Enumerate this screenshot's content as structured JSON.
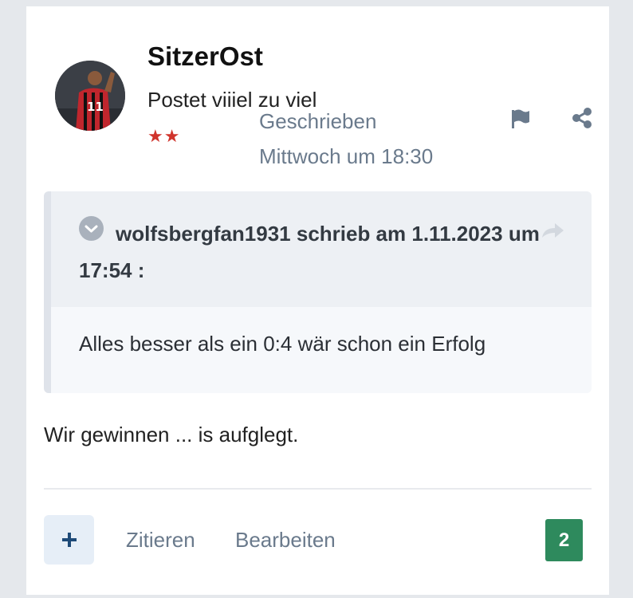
{
  "post": {
    "author": {
      "name": "SitzerOst",
      "title": "Postet viiiel zu viel",
      "rank_stars": "★★"
    },
    "date_label": "Geschrieben",
    "date_value": "Mittwoch um 18:30",
    "quote": {
      "author_line": "wolfsbergfan1931 schrieb am 1.11.2023 um 17:54 :",
      "text": "Alles besser als ein 0:4 wär schon ein Erfolg"
    },
    "content": "Wir gewinnen ... is aufglegt.",
    "actions": {
      "quote_label": "Zitieren",
      "edit_label": "Bearbeiten"
    },
    "reaction_count": "2"
  },
  "icons": {
    "report": "flag-icon",
    "share": "share-icon",
    "toggle": "chevron-down-icon",
    "quote_link": "arrow-share-icon",
    "add": "plus-icon"
  },
  "colors": {
    "accent_text": "#6a7a8c",
    "reaction_green": "#2e8a5d",
    "star_red": "#d0342c",
    "plus_dark": "#1e4a78"
  }
}
